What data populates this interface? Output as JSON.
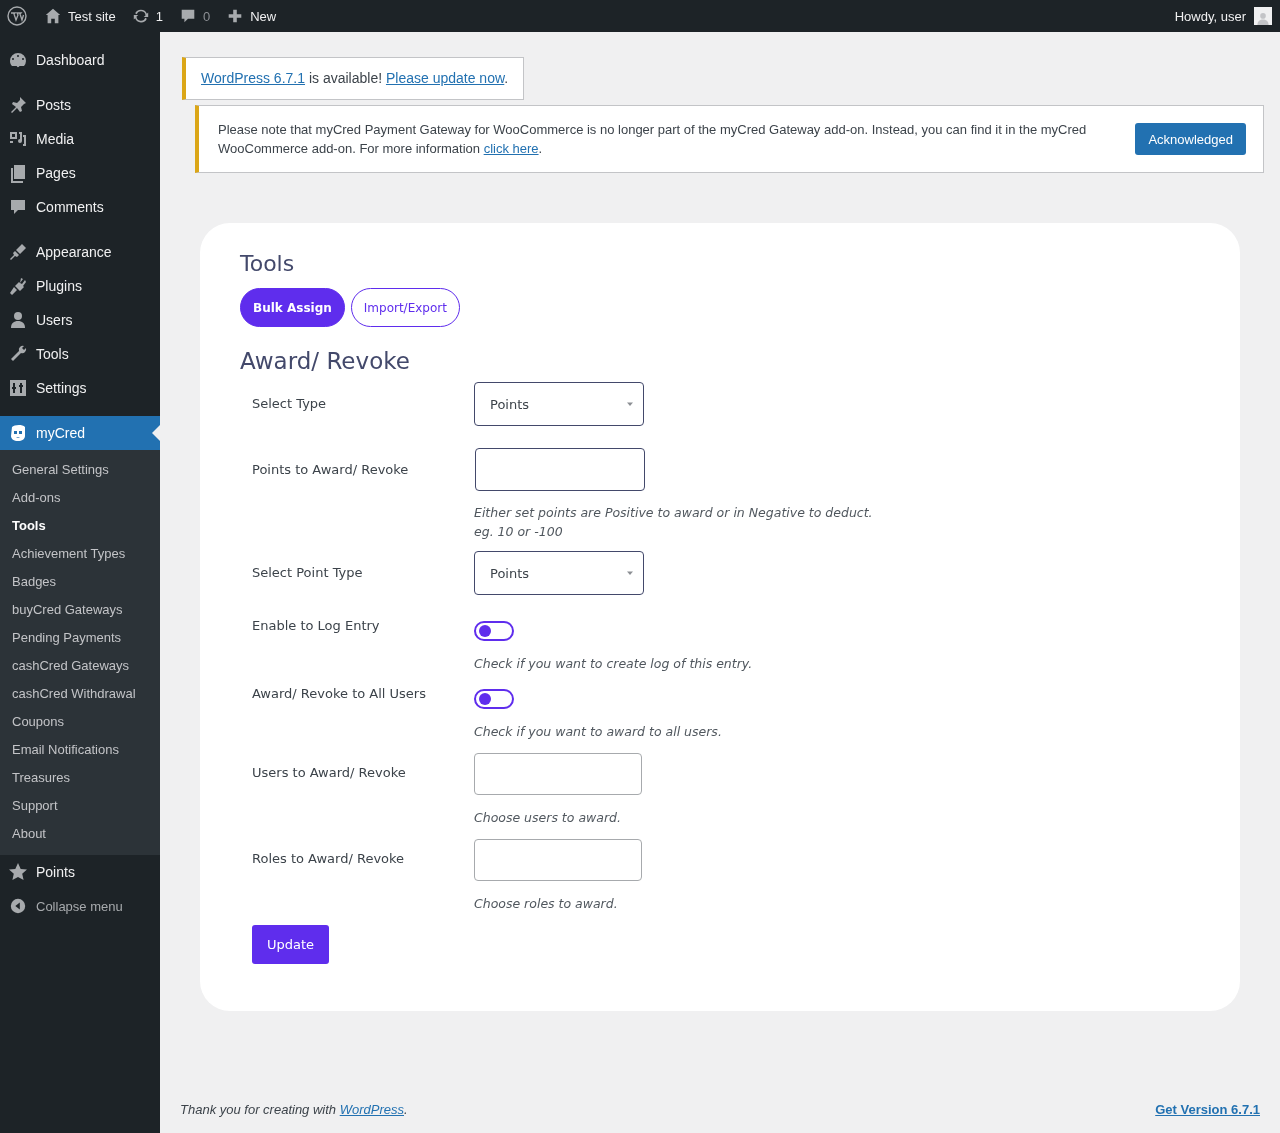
{
  "admin_bar": {
    "site": "Test site",
    "updates": "1",
    "comments": "0",
    "new": "New",
    "greeting": "Howdy, user"
  },
  "sidebar": {
    "groups": [
      {
        "items": [
          {
            "label": "Dashboard",
            "selected": false
          }
        ]
      },
      {
        "items": [
          {
            "label": "Posts",
            "selected": false
          },
          {
            "label": "Media",
            "selected": false
          },
          {
            "label": "Pages",
            "selected": false
          },
          {
            "label": "Comments",
            "selected": false
          }
        ]
      },
      {
        "items": [
          {
            "label": "Appearance",
            "selected": false
          },
          {
            "label": "Plugins",
            "selected": false
          },
          {
            "label": "Users",
            "selected": false
          },
          {
            "label": "Tools",
            "selected": false
          },
          {
            "label": "Settings",
            "selected": false
          }
        ]
      },
      {
        "items": [
          {
            "label": "myCred",
            "selected": true,
            "children": [
              {
                "label": "General Settings",
                "selected": false
              },
              {
                "label": "Add-ons",
                "selected": false
              },
              {
                "label": "Tools",
                "selected": true
              },
              {
                "label": "Achievement Types",
                "selected": false
              },
              {
                "label": "Badges",
                "selected": false
              },
              {
                "label": "buyCred Gateways",
                "selected": false
              },
              {
                "label": "Pending Payments",
                "selected": false
              },
              {
                "label": "cashCred Gateways",
                "selected": false
              },
              {
                "label": "cashCred Withdrawal",
                "selected": false
              },
              {
                "label": "Coupons",
                "selected": false
              },
              {
                "label": "Email Notifications",
                "selected": false
              },
              {
                "label": "Treasures",
                "selected": false
              },
              {
                "label": "Support",
                "selected": false
              },
              {
                "label": "About",
                "selected": false
              }
            ]
          },
          {
            "label": "Points",
            "selected": false
          }
        ]
      }
    ],
    "collapse": "Collapse menu"
  },
  "notices": [
    {
      "kind": "update",
      "parts": [
        {
          "kind": "link",
          "text": "WordPress 6.7.1"
        },
        {
          "kind": "text",
          "text": " is available! "
        },
        {
          "kind": "link",
          "text": "Please update now"
        },
        {
          "kind": "text",
          "text": "."
        }
      ]
    },
    {
      "kind": "warning",
      "parts": [
        {
          "kind": "text",
          "text": "Please note that myCred Payment Gateway for WooCommerce is no longer part of the myCred Gateway add-on. Instead, you can find it in the myCred WooCommerce add-on. For more information "
        },
        {
          "kind": "link",
          "text": "click here"
        },
        {
          "kind": "text",
          "text": "."
        }
      ],
      "button": "Acknowledged"
    }
  ],
  "panel": {
    "title": "Tools",
    "tabs": [
      {
        "label": "Bulk Assign",
        "selected": true
      },
      {
        "label": "Import/Export",
        "selected": false
      }
    ],
    "heading": "Award/ Revoke",
    "fields": [
      {
        "kind": "select",
        "label": "Select Type",
        "value": "Points"
      },
      {
        "kind": "text",
        "label": "Points to Award/ Revoke",
        "hint": "Either set points are Positive to award or in Negative to deduct.\neg. 10 or -100"
      },
      {
        "kind": "select",
        "label": "Select Point Type",
        "value": "Points"
      },
      {
        "kind": "toggle",
        "label": "Enable to Log Entry",
        "on": false,
        "hint": "Check if you want to create log of this entry."
      },
      {
        "kind": "toggle",
        "label": "Award/ Revoke to All Users",
        "on": false,
        "hint": "Check if you want to award to all users."
      },
      {
        "kind": "tags",
        "label": "Users to Award/ Revoke",
        "hint": "Choose users to award."
      },
      {
        "kind": "tags",
        "label": "Roles to Award/ Revoke",
        "hint": "Choose roles to award."
      }
    ],
    "button": "Update"
  },
  "footer": {
    "parts": [
      {
        "kind": "text",
        "text": "Thank you for creating with "
      },
      {
        "kind": "link",
        "text": "WordPress"
      },
      {
        "kind": "text",
        "text": "."
      }
    ],
    "version": "Get Version 6.7.1"
  }
}
